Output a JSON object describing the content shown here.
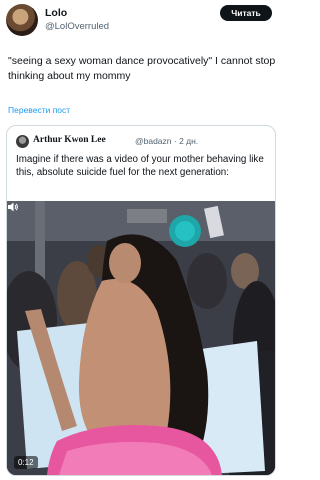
{
  "user": {
    "name": "Lolo",
    "handle": "@LolOverruled",
    "follow_label": "Читать"
  },
  "tweet": {
    "text": "\"seeing a sexy woman dance provocatively\" I cannot stop thinking about my mommy",
    "translate_label": "Перевести пост"
  },
  "quote": {
    "name": "Arthur Kwon Lee",
    "meta": "@badazn · 2 дн.",
    "text": "Imagine if there was a video of your mother behaving like this, absolute suicide fuel for the next generation:"
  },
  "video": {
    "duration": "0:12",
    "volume_icon": "volume-icon"
  }
}
